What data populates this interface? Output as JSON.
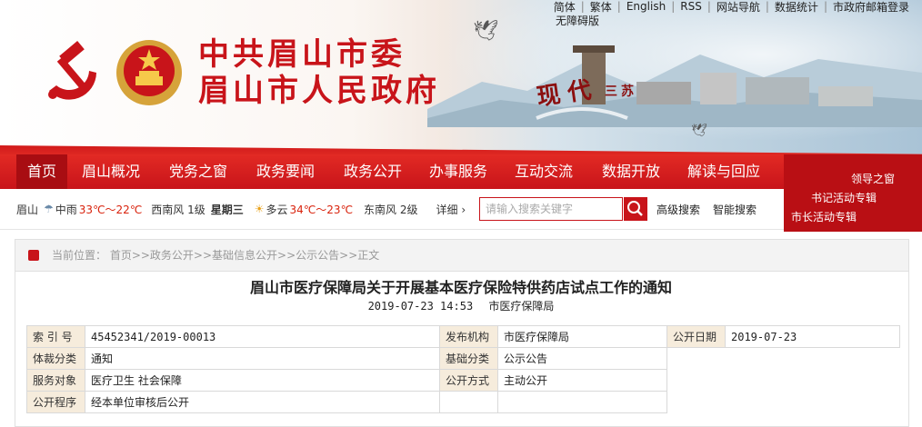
{
  "top_links": [
    "简体",
    "繁体",
    "English",
    "RSS",
    "网站导航",
    "数据统计",
    "市政府邮箱登录"
  ],
  "accessible_label": "无障碍版",
  "site_title_line1": "中共眉山市委",
  "site_title_line2": "眉山市人民政府",
  "banner_text": "现代",
  "banner_subtext": "三苏",
  "nav": [
    "首页",
    "眉山概况",
    "党务之窗",
    "政务要闻",
    "政务公开",
    "办事服务",
    "互动交流",
    "数据开放",
    "解读与回应"
  ],
  "right_links": [
    "领导之窗",
    "书记活动专辑",
    "市长活动专辑"
  ],
  "weather": {
    "city": "眉山",
    "today_cond": "中雨",
    "today_temp": "33℃～22℃",
    "today_wind": "西南风 1级",
    "day_label": "星期三",
    "tomorrow_cond": "多云",
    "tomorrow_temp": "34℃～23℃",
    "tomorrow_wind": "东南风 2级",
    "detail_label": "详细"
  },
  "search": {
    "placeholder": "请输入搜索关键字",
    "advanced": "高级搜索",
    "smart": "智能搜索"
  },
  "breadcrumb": "当前位置：  首页>>政务公开>>基础信息公开>>公示公告>>正文",
  "article": {
    "title": "眉山市医疗保障局关于开展基本医疗保险特供药店试点工作的通知",
    "date": "2019-07-23 14:53",
    "source": "市医疗保障局"
  },
  "info_table": [
    [
      "索 引 号",
      "45452341/2019-00013",
      "发布机构",
      "市医疗保障局",
      "公开日期",
      "2019-07-23"
    ],
    [
      "体裁分类",
      "通知",
      "基础分类",
      "公示公告",
      "",
      ""
    ],
    [
      "服务对象",
      "医疗卫生 社会保障",
      "公开方式",
      "主动公开",
      "",
      ""
    ],
    [
      "公开程序",
      "经本单位审核后公开",
      "",
      "",
      "",
      ""
    ]
  ],
  "colors": {
    "brand_red": "#c8141a",
    "label_bg": "#f6ecdc"
  }
}
